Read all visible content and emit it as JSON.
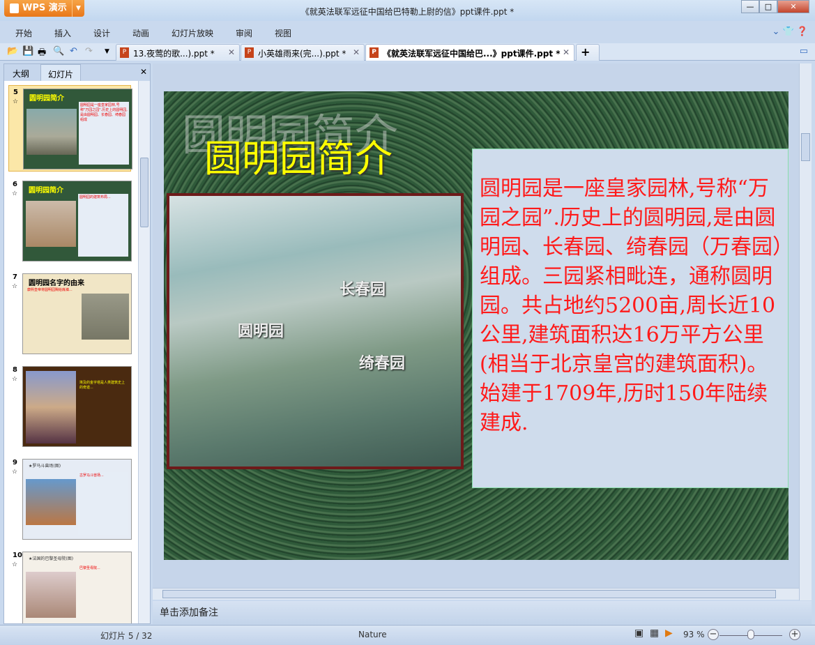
{
  "app": {
    "name": "WPS 演示",
    "window_title": "《就英法联军远征中国给巴特勒上尉的信》ppt课件.ppt *"
  },
  "menu": [
    "开始",
    "插入",
    "设计",
    "动画",
    "幻灯片放映",
    "审阅",
    "视图"
  ],
  "tabs": [
    {
      "label": "13.夜莺的歌...).ppt *"
    },
    {
      "label": "小英雄雨来(完...).ppt *"
    },
    {
      "label": "《就英法联军远征中国给巴...》ppt课件.ppt *"
    }
  ],
  "left_tabs": [
    "大纲",
    "幻灯片"
  ],
  "thumbnails": [
    {
      "num": "5",
      "title": "圆明园简介",
      "text": "圆明园是一座皇家园林,号称\"万园之园\".历史上的圆明园,是由圆明园、长春园、绮春园组成"
    },
    {
      "num": "6",
      "title": "圆明园简介",
      "text": "圆明园的建筑布局..."
    },
    {
      "num": "7",
      "title": "圆明园名字的由来",
      "text": "康熙皇帝将圆明园赐给胤禛..."
    },
    {
      "num": "8",
      "title": "",
      "text": "埃及的金字塔是人类建筑史上的奇迹..."
    },
    {
      "num": "9",
      "title": "★罗马斗兽场(图)",
      "text": "古罗马斗兽场..."
    },
    {
      "num": "10",
      "title": "★法国的巴黎圣母院(图)",
      "text": "巴黎圣母院..."
    }
  ],
  "slide": {
    "bg_title": "圆明园简介",
    "title": "圆明园简介",
    "labels": [
      "长春园",
      "圆明园",
      "绮春园"
    ],
    "body": "圆明园是一座皇家园林,号称“万园之园”.历史上的圆明园,是由圆明园、长春园、绮春园（万春园）组成。三园紧相毗连，通称圆明园。共占地约5200亩,周长近10公里,建筑面积达16万平方公里(相当于北京皇宫的建筑面积)。始建于1709年,历时150年陆续建成."
  },
  "notes_placeholder": "单击添加备注",
  "status": {
    "slide_counter": "幻灯片 5 / 32",
    "theme": "Nature",
    "zoom": "93 %",
    "zoom_percent": 93
  }
}
